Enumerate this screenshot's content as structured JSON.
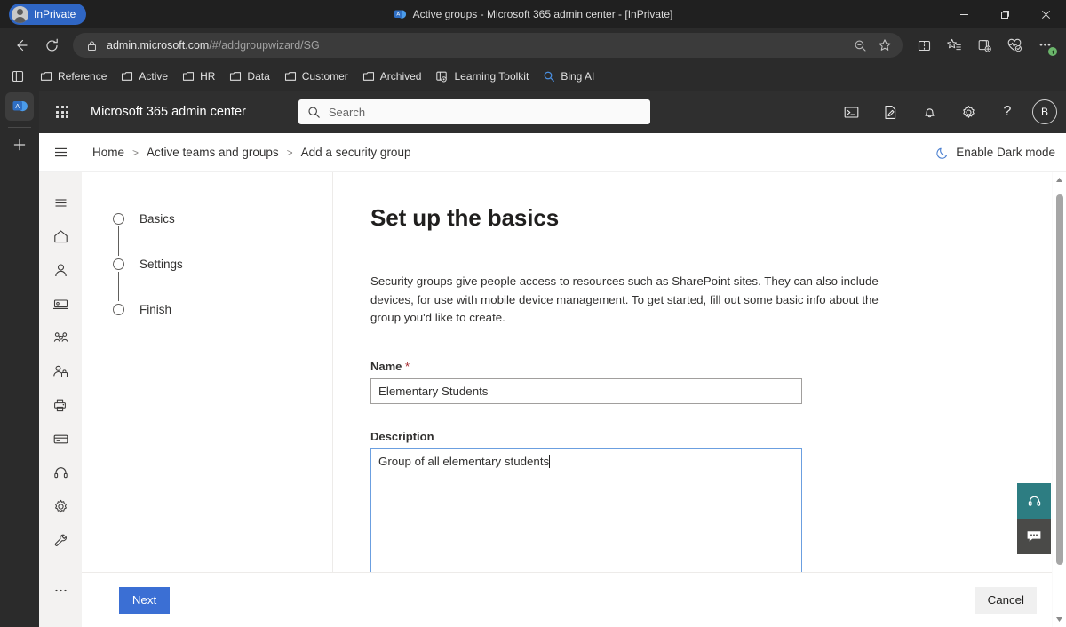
{
  "browser": {
    "inprivate_label": "InPrivate",
    "window_title": "Active groups - Microsoft 365 admin center - [InPrivate]",
    "url_host": "admin.microsoft.com",
    "url_path": "/#/addgroupwizard/SG",
    "window_controls": {
      "minimize": "minimize-icon",
      "restore": "restore-icon",
      "close": "close-icon"
    },
    "nav": {
      "back": "back-arrow-icon",
      "refresh": "refresh-icon",
      "lock": "lock-icon",
      "zoom_out": "zoom-out-icon",
      "favorite": "star-icon",
      "split_screen": "split-screen-icon",
      "favorites": "favorites-list-icon",
      "collections": "collections-icon",
      "browser_essentials": "browser-essentials-icon",
      "settings_more": "ellipsis-icon"
    },
    "bookmarks": [
      {
        "label": "Reference",
        "icon": "folder-icon"
      },
      {
        "label": "Active",
        "icon": "folder-icon"
      },
      {
        "label": "HR",
        "icon": "folder-icon"
      },
      {
        "label": "Data",
        "icon": "folder-icon"
      },
      {
        "label": "Customer",
        "icon": "folder-icon"
      },
      {
        "label": "Archived",
        "icon": "folder-icon"
      },
      {
        "label": "Learning Toolkit",
        "icon": "learning-toolkit-icon"
      },
      {
        "label": "Bing AI",
        "icon": "bing-search-icon"
      }
    ],
    "tab_rail": {
      "tab_icon": "m365-admin-favicon",
      "new_tab": "plus-icon"
    }
  },
  "app": {
    "header": {
      "waffle": "app-launcher-icon",
      "title": "Microsoft 365 admin center",
      "search_placeholder": "Search",
      "search_value": "",
      "actions": [
        {
          "name": "console-icon"
        },
        {
          "name": "whats-new-icon"
        },
        {
          "name": "bell-icon"
        },
        {
          "name": "gear-icon"
        },
        {
          "name": "help-icon"
        }
      ],
      "avatar_initial": "B"
    },
    "breadcrumb": {
      "hamburger": "hamburger-icon",
      "items": [
        "Home",
        "Active teams and groups",
        "Add a security group"
      ],
      "separator": ">"
    },
    "dark_mode": {
      "label": "Enable Dark mode",
      "icon": "moon-icon"
    },
    "rail_icons": [
      "hamburger-icon",
      "home-icon",
      "user-icon",
      "device-icon",
      "teams-icon",
      "roles-icon",
      "printer-icon",
      "billing-icon",
      "support-icon",
      "settings-gear-icon",
      "setup-wrench-icon",
      "more-ellipsis-icon"
    ]
  },
  "wizard": {
    "steps": [
      {
        "label": "Basics",
        "state": "current"
      },
      {
        "label": "Settings",
        "state": "pending"
      },
      {
        "label": "Finish",
        "state": "pending"
      }
    ],
    "title": "Set up the basics",
    "description": "Security groups give people access to resources such as SharePoint sites. They can also include devices, for use with mobile device management. To get started, fill out some basic info about the group you'd like to create.",
    "name_field": {
      "label": "Name",
      "required_marker": "*",
      "value": "Elementary Students",
      "placeholder": ""
    },
    "description_field": {
      "label": "Description",
      "value": "Group of all elementary students",
      "placeholder": ""
    },
    "buttons": {
      "next": "Next",
      "cancel": "Cancel"
    }
  },
  "floating": {
    "help": "support-headset-icon",
    "feedback": "feedback-chat-icon"
  },
  "scrollbar": {
    "up": "scroll-up-arrow",
    "down": "scroll-down-arrow"
  },
  "colors": {
    "accent_blue": "#3b6fd4",
    "inprivate_blue": "#2f66c4",
    "chrome_dark": "#2b2b2b",
    "titlebar_dark": "#202020",
    "m365_header": "#2f2f2f",
    "rail_bg": "#f3f2f1",
    "required_red": "#a4262c",
    "focus_border": "#6b9fe0",
    "help_teal": "#2d7d82",
    "feedback_gray": "#4a4a48"
  }
}
